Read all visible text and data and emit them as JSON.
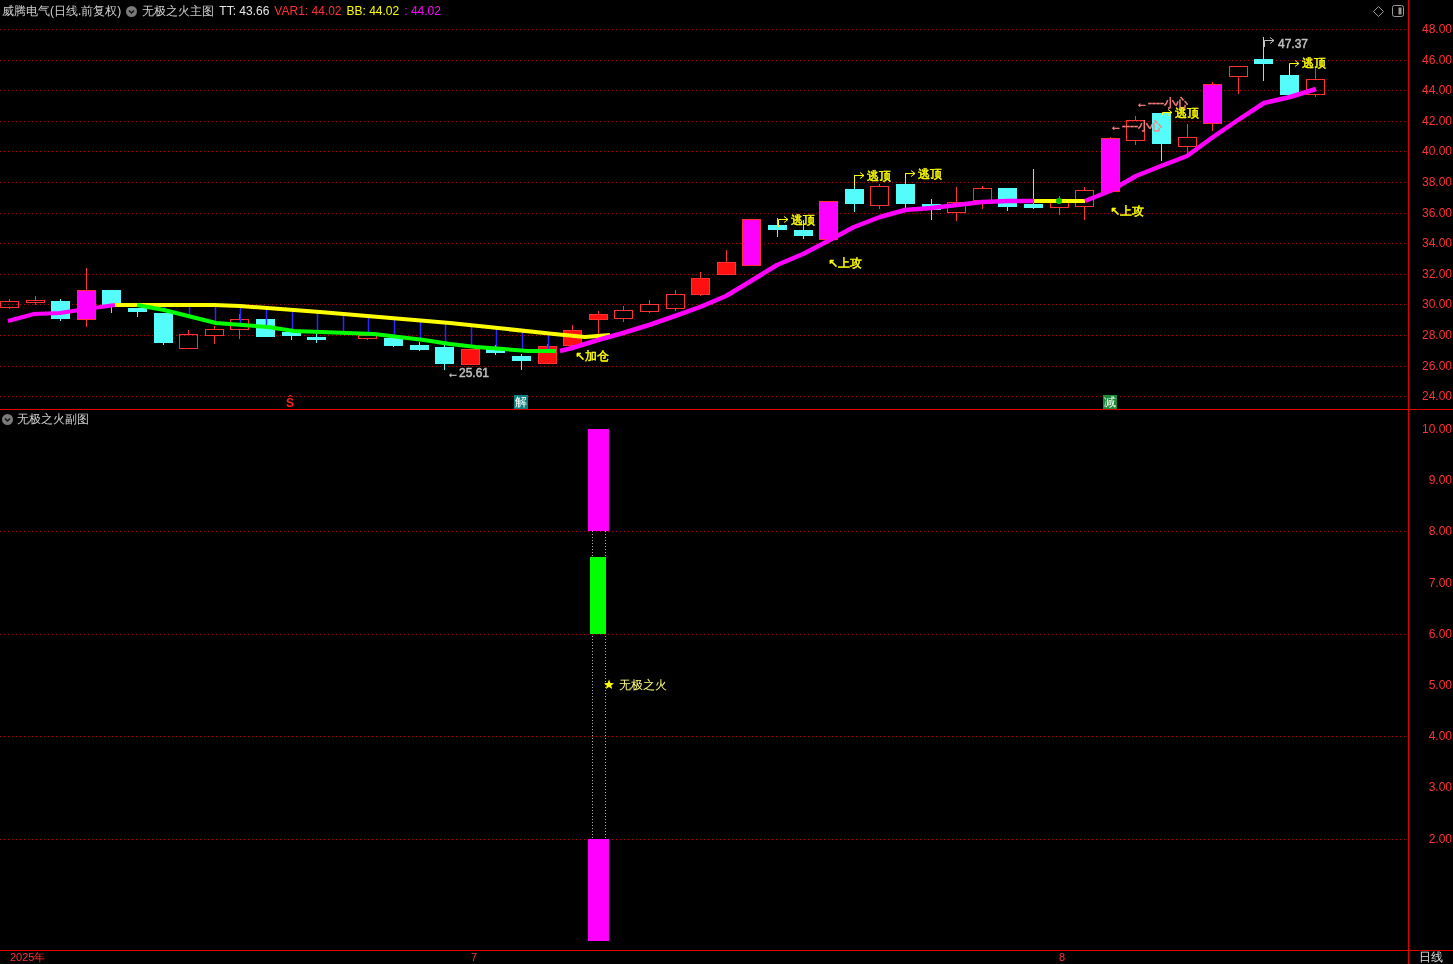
{
  "header": {
    "stock": "威腾电气(日线.前复权)",
    "indicator": "无极之火主图",
    "readings": [
      {
        "text": "TT: 43.66",
        "color": "#e6e6e6"
      },
      {
        "text": "VAR1: 44.02",
        "color": "#ff3232"
      },
      {
        "text": "BB: 44.02",
        "color": "#ffff00"
      },
      {
        "text": ": 44.02",
        "color": "#ff00ff"
      }
    ]
  },
  "main_chart": {
    "price_axis": [
      "48.00",
      "46.00",
      "44.00",
      "42.00",
      "40.00",
      "38.00",
      "36.00",
      "34.00",
      "32.00",
      "30.00",
      "28.00",
      "26.00",
      "24.00"
    ],
    "annotations": [
      {
        "kind": "note",
        "text": "←25.61",
        "color": "#c0c0c0"
      },
      {
        "kind": "note",
        "text": "↖加仓",
        "color": "#ffff00"
      },
      {
        "kind": "flag",
        "text": "逃顶",
        "color": "#ffff00"
      },
      {
        "kind": "note",
        "text": "↖上攻",
        "color": "#ffff00"
      },
      {
        "kind": "flag",
        "text": "逃顶",
        "color": "#ffff00"
      },
      {
        "kind": "flag",
        "text": "逃顶",
        "color": "#ffff00"
      },
      {
        "kind": "note",
        "text": "←----小心",
        "color": "#ff8080"
      },
      {
        "kind": "note",
        "text": "↖上攻",
        "color": "#ffff00"
      },
      {
        "kind": "note",
        "text": "←----小心",
        "color": "#ff8080"
      },
      {
        "kind": "flag",
        "text": "逃顶",
        "color": "#ffff00"
      },
      {
        "kind": "flag",
        "text": "47.37",
        "color": "#c0c0c0"
      },
      {
        "kind": "flag",
        "text": "逃顶",
        "color": "#ffff00"
      }
    ],
    "signals": [
      {
        "kind": "sell",
        "text": "Ŝ"
      },
      {
        "kind": "release",
        "text": "解"
      },
      {
        "kind": "reduce",
        "text": "减"
      }
    ]
  },
  "sub_chart": {
    "title": "无极之火副图",
    "label": "无极之火",
    "value_axis": [
      "10.00",
      "9.00",
      "8.00",
      "7.00",
      "6.00",
      "5.00",
      "4.00",
      "3.00",
      "2.00"
    ]
  },
  "time_axis": [
    "2025年",
    "7",
    "8"
  ],
  "period_button": "日线"
}
